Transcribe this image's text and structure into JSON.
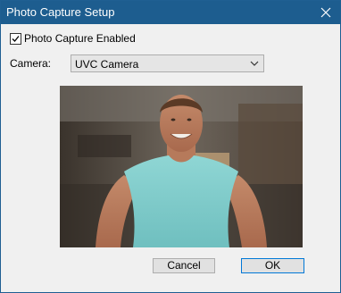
{
  "window": {
    "title": "Photo Capture Setup"
  },
  "photo_capture": {
    "label": "Photo Capture Enabled",
    "checked": true
  },
  "camera": {
    "label": "Camera:",
    "selected": "UVC Camera"
  },
  "preview": {
    "description_icon": "camera-preview-image"
  },
  "buttons": {
    "cancel": "Cancel",
    "ok": "OK"
  },
  "colors": {
    "titlebar": "#1d5d8f",
    "dialog_bg": "#f0f0f0",
    "ok_border": "#0078d7"
  }
}
